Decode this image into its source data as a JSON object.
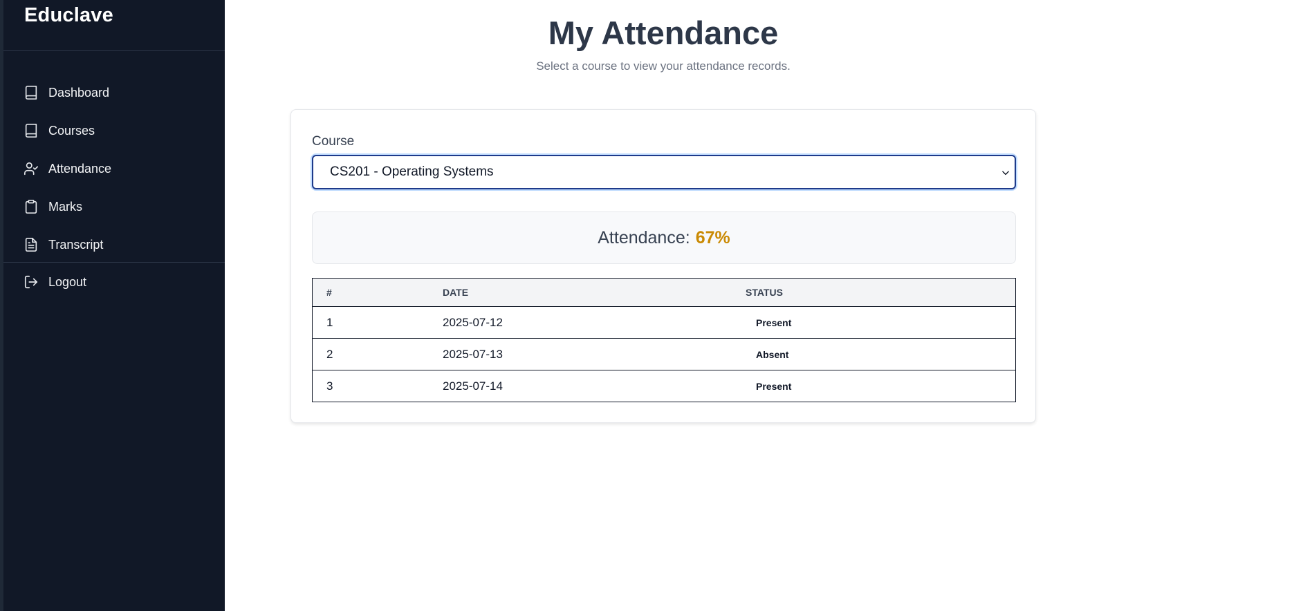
{
  "app": {
    "brand": "Educlave"
  },
  "sidebar": {
    "items": [
      {
        "label": "Dashboard",
        "icon": "book-icon"
      },
      {
        "label": "Courses",
        "icon": "book-icon"
      },
      {
        "label": "Attendance",
        "icon": "user-check-icon"
      },
      {
        "label": "Marks",
        "icon": "clipboard-icon"
      },
      {
        "label": "Transcript",
        "icon": "file-text-icon"
      },
      {
        "label": "Logout",
        "icon": "logout-icon"
      }
    ]
  },
  "page": {
    "title": "My Attendance",
    "subtitle": "Select a course to view your attendance records."
  },
  "course_picker": {
    "label": "Course",
    "selected": "CS201 - Operating Systems"
  },
  "summary": {
    "label": "Attendance:",
    "value": "67%",
    "value_color": "#ca8a04"
  },
  "table": {
    "headers": [
      "#",
      "DATE",
      "STATUS"
    ],
    "rows": [
      {
        "num": "1",
        "date": "2025-07-12",
        "status": "Present"
      },
      {
        "num": "2",
        "date": "2025-07-13",
        "status": "Absent"
      },
      {
        "num": "3",
        "date": "2025-07-14",
        "status": "Present"
      }
    ]
  },
  "colors": {
    "sidebar_bg": "#111827",
    "accent": "#1e3a8a"
  }
}
